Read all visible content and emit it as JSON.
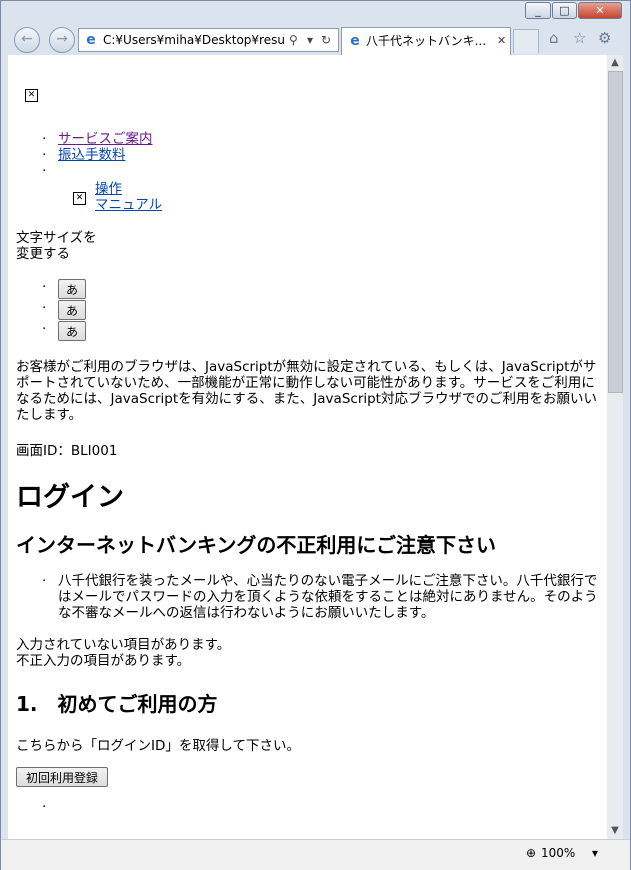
{
  "titlebar": {
    "minimize": "_",
    "maximize": "□",
    "close": "✕"
  },
  "address_bar": {
    "url": "C:¥Users¥miha¥Desktop¥resu",
    "search_icon": "magnifier-icon",
    "dropdown": "▾",
    "refresh": "↻"
  },
  "tab": {
    "title": "八千代ネットバンキ...",
    "close": "✕"
  },
  "toolbar": {
    "home": "⌂",
    "favorites": "☆",
    "tools": "⚙"
  },
  "page": {
    "menu": [
      "サービスご案内",
      "振込手数料"
    ],
    "manual_link": "操作\nマニュアル",
    "textsize_label": "文字サイズを\n変更する",
    "textsize_buttons": [
      "あ",
      "あ",
      "あ"
    ],
    "js_warning": "お客様がご利用のブラウザは、JavaScriptが無効に設定されている、もしくは、JavaScriptがサポートされていないため、一部機能が正常に動作しない可能性があります。サービスをご利用になるためには、JavaScriptを有効にする、また、JavaScript対応ブラウザでのご利用をお願いいたします。",
    "screen_id": "画面ID：BLI001",
    "heading": "ログイン",
    "notice_heading": "インターネットバンキングの不正利用にご注意下さい",
    "notice_item": "八千代銀行を装ったメールや、心当たりのない電子メールにご注意下さい。八千代銀行ではメールでパスワードの入力を頂くような依頼をすることは絶対にありません。そのような不審なメールへの返信は行わないようにお願いいたします。",
    "error_lines": [
      "入力されていない項目があります。",
      "不正入力の項目があります。"
    ],
    "first_time_heading": "1.　初めてご利用の方",
    "first_time_text": "こちらから「ログインID」を取得して下さい。",
    "register_button": "初回利用登録"
  },
  "status_bar": {
    "zoom": "100%",
    "zoom_dropdown": "▾"
  }
}
